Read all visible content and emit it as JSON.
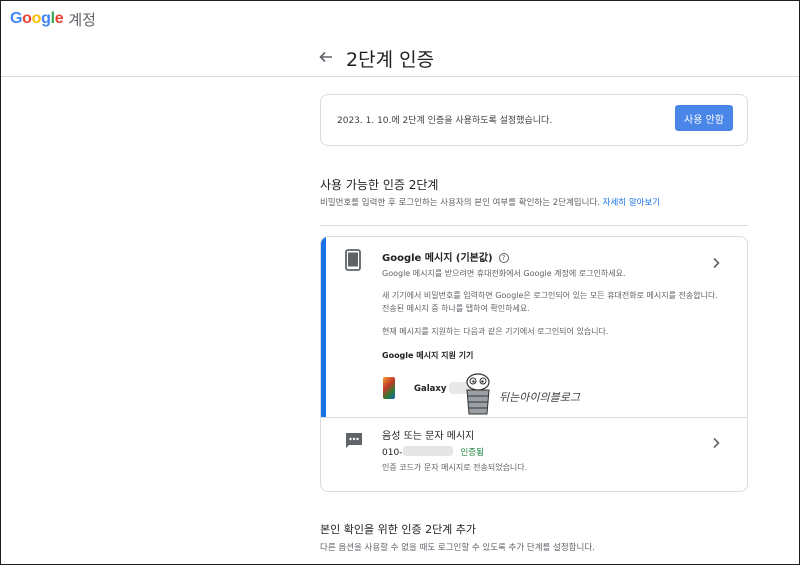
{
  "app": {
    "logo_letters": [
      "G",
      "o",
      "o",
      "g",
      "l",
      "e"
    ],
    "logo_suffix": "계정"
  },
  "header": {
    "back_icon": "arrow-left-icon",
    "title": "2단계 인증"
  },
  "status": {
    "text": "2023. 1. 10.에 2단계 인증을 사용하도록 설정했습니다.",
    "button_label": "사용 안함",
    "button_color": "#4a86e8"
  },
  "available": {
    "title": "사용 가능한 인증 2단계",
    "description": "비밀번호를 입력한 후 로그인하는 사용자의 본인 여부를 확인하는 2단계입니다.",
    "learn_more": "자세히 알아보기"
  },
  "methods": {
    "google_prompt": {
      "title": "Google 메시지 (기본값)",
      "help_icon": "help-circle-icon",
      "subtitle": "Google 메시지를 받으려면 휴대전화에서 Google 계정에 로그인하세요.",
      "paragraph1": "새 기기에서 비밀번호를 입력하면 Google은 로그인되어 있는 모든 휴대전화로 메시지를 전송합니다. 전송된 메시지 중 하나를 탭하여 확인하세요.",
      "paragraph2": "현재 메시지를 지원하는 다음과 같은 기기에서 로그인되어 있습니다.",
      "devices_title": "Google 메시지 지원 기기",
      "device_name": "Galaxy",
      "watermark_text": "뒤는아이의블로그",
      "accent_color": "#1a73e8"
    },
    "sms": {
      "title": "음성 또는 문자 메시지",
      "phone_prefix": "010-",
      "verified_label": "인증됨",
      "verified_color": "#188038",
      "subtitle": "인증 코드가 문자 메시지로 전송되었습니다."
    }
  },
  "add_section": {
    "title": "본인 확인을 위한 인증 2단계 추가",
    "description": "다른 옵션을 사용할 수 없을 때도 로그인할 수 있도록 추가 단계를 설정합니다."
  }
}
